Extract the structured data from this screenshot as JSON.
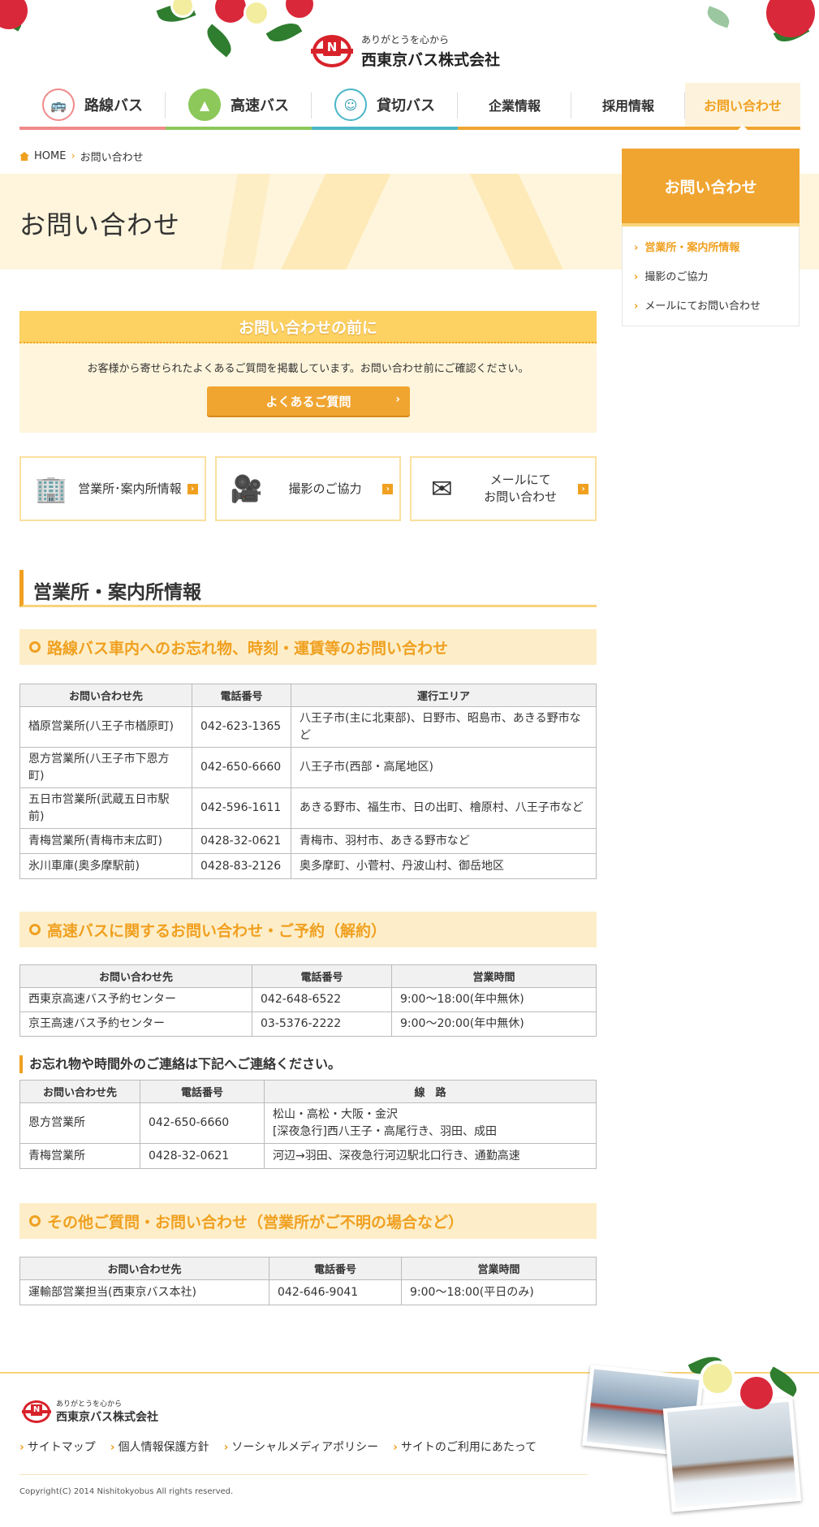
{
  "header": {
    "tagline": "ありがとうを心から",
    "company": "西東京バス株式会社",
    "logo_letter": "N"
  },
  "nav": [
    {
      "label": "路線バス",
      "icon": "bus-icon",
      "color": "#f08a8a"
    },
    {
      "label": "高速バス",
      "icon": "highway-icon",
      "color": "#8cc85a"
    },
    {
      "label": "貸切バス",
      "icon": "guide-icon",
      "color": "#4ab6c8"
    },
    {
      "label": "企業情報",
      "color": "#f0a530"
    },
    {
      "label": "採用情報",
      "color": "#f0a530"
    },
    {
      "label": "お問い合わせ",
      "color": "#f0a530",
      "active": true
    }
  ],
  "breadcrumb": {
    "home": "HOME",
    "current": "お問い合わせ"
  },
  "page_title": "お問い合わせ",
  "side": {
    "title": "お問い合わせ",
    "links": [
      "営業所・案内所情報",
      "撮影のご協力",
      "メールにてお問い合わせ"
    ]
  },
  "notice": {
    "title": "お問い合わせの前に",
    "text": "お客様から寄せられたよくあるご質問を掲載しています。お問い合わせ前にご確認ください。",
    "button": "よくあるご質問"
  },
  "cards": [
    {
      "label": "営業所･案内所情報",
      "icon": "building-icon"
    },
    {
      "label": "撮影のご協力",
      "icon": "movie-camera-icon"
    },
    {
      "label": "メールにて\nお問い合わせ",
      "icon": "envelope-icon"
    }
  ],
  "section_title": "営業所・案内所情報",
  "route": {
    "heading": "路線バス車内へのお忘れ物、時刻・運賃等のお問い合わせ",
    "headers": [
      "お問い合わせ先",
      "電話番号",
      "運行エリア"
    ],
    "rows": [
      [
        "楢原営業所(八王子市楢原町)",
        "042-623-1365",
        "八王子市(主に北東部)、日野市、昭島市、あきる野市など"
      ],
      [
        "恩方営業所(八王子市下恩方町)",
        "042-650-6660",
        "八王子市(西部・高尾地区)"
      ],
      [
        "五日市営業所(武蔵五日市駅前)",
        "042-596-1611",
        "あきる野市、福生市、日の出町、檜原村、八王子市など"
      ],
      [
        "青梅営業所(青梅市末広町)",
        "0428-32-0621",
        "青梅市、羽村市、あきる野市など"
      ],
      [
        "氷川車庫(奥多摩駅前)",
        "0428-83-2126",
        "奥多摩町、小菅村、丹波山村、御岳地区"
      ]
    ]
  },
  "highway": {
    "heading": "高速バスに関するお問い合わせ・ご予約（解約）",
    "headers": [
      "お問い合わせ先",
      "電話番号",
      "営業時間"
    ],
    "rows": [
      [
        "西東京高速バス予約センター",
        "042-648-6522",
        "9:00〜18:00(年中無休)"
      ],
      [
        "京王高速バス予約センター",
        "03-5376-2222",
        "9:00〜20:00(年中無休)"
      ]
    ]
  },
  "lost": {
    "heading": "お忘れ物や時間外のご連絡は下記へご連絡ください。",
    "headers": [
      "お問い合わせ先",
      "電話番号",
      "線　路"
    ],
    "rows": [
      [
        "恩方営業所",
        "042-650-6660",
        "松山・高松・大阪・金沢\n[深夜急行]西八王子・高尾行き、羽田、成田"
      ],
      [
        "青梅営業所",
        "0428-32-0621",
        "河辺→羽田、深夜急行河辺駅北口行き、通勤高速"
      ]
    ]
  },
  "other": {
    "heading": "その他ご質問・お問い合わせ（営業所がご不明の場合など）",
    "headers": [
      "お問い合わせ先",
      "電話番号",
      "営業時間"
    ],
    "rows": [
      [
        "運輸部営業担当(西東京バス本社)",
        "042-646-9041",
        "9:00〜18:00(平日のみ)"
      ]
    ]
  },
  "footer": {
    "tagline": "ありがとうを心から",
    "company": "西東京バス株式会社",
    "links": [
      "サイトマップ",
      "個人情報保護方針",
      "ソーシャルメディアポリシー",
      "サイトのご利用にあたって"
    ],
    "copyright": "Copyright(C) 2014 Nishitokyobus All rights reserved."
  },
  "colors": {
    "accent": "#f0a530",
    "brand_red": "#d8222a"
  }
}
